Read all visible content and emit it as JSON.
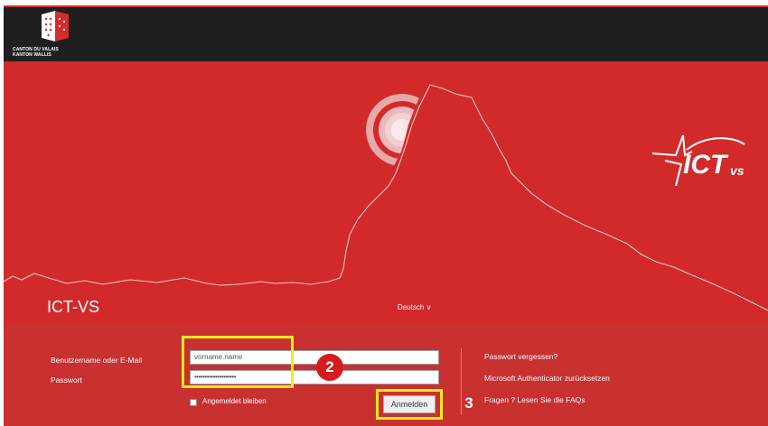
{
  "header": {
    "canton_line1": "CANTON DU VALAIS",
    "canton_line2": "KANTON WALLIS"
  },
  "hero": {
    "site_title": "ICT-VS",
    "language": "Deutsch ∨",
    "brand_logo_text": "ICT",
    "brand_logo_sub": "vs"
  },
  "login": {
    "username_label": "Benutzername oder E-Mail",
    "password_label": "Passwort",
    "username_value": "vorname.name",
    "password_value": "••••••••••••••••••••",
    "remember_label": "Angemeldet bleiben",
    "submit_label": "Anmelden"
  },
  "links": {
    "forgot": "Passwort vergessen?",
    "authenticator": "Microsoft Authenticator zurücksetzen",
    "faq": "Fragen ? Lesen Sie die FAQs"
  },
  "annotations": {
    "step2": "2",
    "step3": "3"
  },
  "colors": {
    "brand_red": "#d22a2a",
    "panel_red": "#c93030",
    "header_black": "#1f1f1f",
    "highlight_yellow": "#f4ea1b"
  },
  "icons": {
    "canton_shield": "canton-shield-icon",
    "sun": "sun-icon",
    "star_logo": "ict-star-logo-icon"
  }
}
